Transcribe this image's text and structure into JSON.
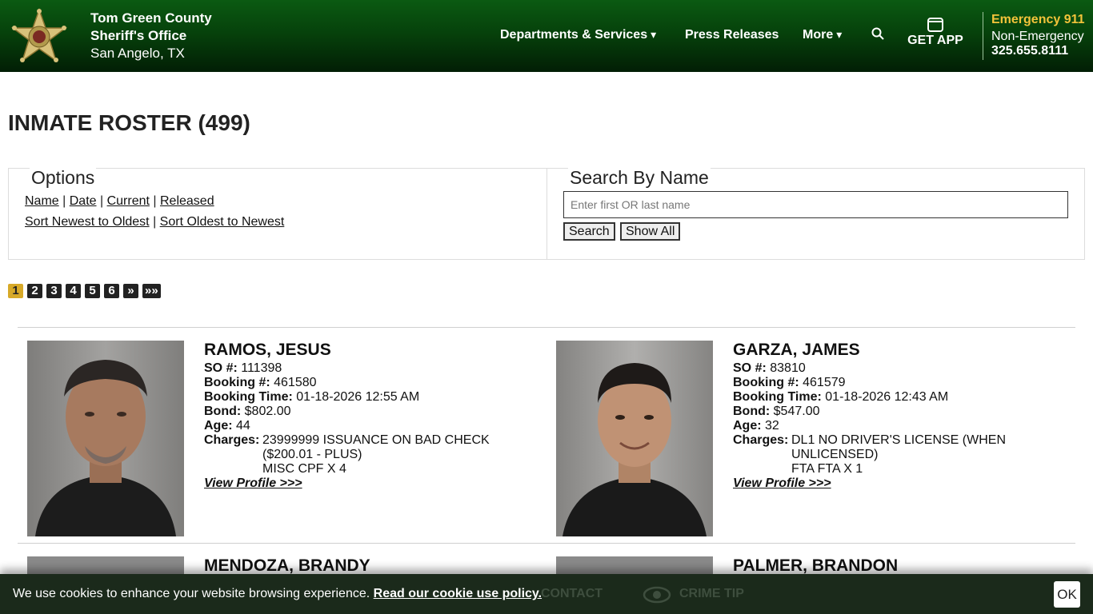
{
  "header": {
    "org_line1": "Tom Green County",
    "org_line2": "Sheriff's Office",
    "org_line3": "San Angelo, TX",
    "nav": [
      {
        "label": "Departments & Services",
        "icon": "chevron-down-icon"
      },
      {
        "label": "Press Releases"
      },
      {
        "label": "More",
        "icon": "chevron-down-icon"
      }
    ],
    "search_icon": "search-icon",
    "get_app": "GET APP",
    "emergency": "Emergency 911",
    "non_emergency": "Non-Emergency",
    "non_emergency_number": "325.655.8111",
    "colors": {
      "header_green": "#06420b",
      "emergency_gold": "#f2c33a"
    }
  },
  "page": {
    "title": "INMATE ROSTER (499)"
  },
  "options": {
    "title": "Options",
    "filter_links": [
      "Name",
      "Date",
      "Current",
      "Released"
    ],
    "sort_links": [
      "Sort Newest to Oldest",
      "Sort Oldest to Newest"
    ]
  },
  "search": {
    "title": "Search By Name",
    "placeholder": "Enter first OR last name",
    "value": "",
    "search_button": "Search",
    "show_all_button": "Show All"
  },
  "pagination": {
    "current": 1,
    "pages": [
      "1",
      "2",
      "3",
      "4",
      "5",
      "6",
      "»",
      "»»"
    ],
    "accent": "#d7a928"
  },
  "inmates": [
    {
      "name": "RAMOS, JESUS",
      "so_label": "SO #:",
      "so": "111398",
      "booking_label": "Booking #:",
      "booking": "461580",
      "time_label": "Booking Time:",
      "time": "01-18-2026 12:55 AM",
      "bond_label": "Bond:",
      "bond": "$802.00",
      "age_label": "Age:",
      "age": "44",
      "charges_label": "Charges:",
      "charges": [
        "23999999 ISSUANCE ON BAD CHECK",
        "($200.01 - PLUS)",
        "MISC CPF X 4"
      ],
      "link": "View Profile >>>"
    },
    {
      "name": "GARZA, JAMES",
      "so_label": "SO #:",
      "so": "83810",
      "booking_label": "Booking #:",
      "booking": "461579",
      "time_label": "Booking Time:",
      "time": "01-18-2026 12:43 AM",
      "bond_label": "Bond:",
      "bond": "$547.00",
      "age_label": "Age:",
      "age": "32",
      "charges_label": "Charges:",
      "charges": [
        "DL1 NO DRIVER'S LICENSE (WHEN",
        "UNLICENSED)",
        "FTA FTA X 1"
      ],
      "link": "View Profile >>>"
    },
    {
      "name": "MENDOZA, BRANDY"
    },
    {
      "name": "PALMER, BRANDON"
    }
  ],
  "footer_bar": {
    "contact": "CONTACT",
    "crime_tip": "CRIME TIP"
  },
  "cookie": {
    "message": "We use cookies to enhance your website browsing experience.",
    "link": "Read our cookie use policy.",
    "ok": "OK"
  }
}
